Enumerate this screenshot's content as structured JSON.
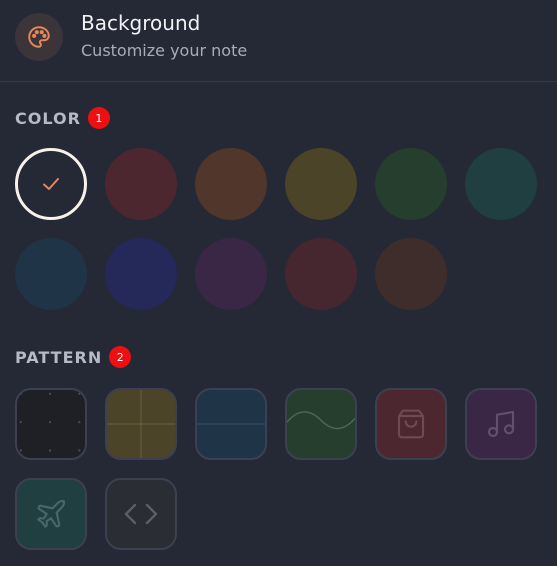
{
  "header": {
    "title": "Background",
    "subtitle": "Customize your note",
    "icon": "palette-icon",
    "icon_color": "#e8865a"
  },
  "color_section": {
    "label": "COLOR",
    "badge": "1",
    "swatches": [
      {
        "name": "default",
        "color": "#252835",
        "selected": true,
        "icon": "check-icon"
      },
      {
        "name": "red",
        "color": "#4c2730",
        "selected": false
      },
      {
        "name": "orange",
        "color": "#51372b",
        "selected": false
      },
      {
        "name": "yellow",
        "color": "#4b4428",
        "selected": false
      },
      {
        "name": "green",
        "color": "#263e2e",
        "selected": false
      },
      {
        "name": "teal",
        "color": "#1f3f40",
        "selected": false
      },
      {
        "name": "blue",
        "color": "#1f3447",
        "selected": false
      },
      {
        "name": "indigo",
        "color": "#24295a",
        "selected": false
      },
      {
        "name": "purple",
        "color": "#3a2645",
        "selected": false
      },
      {
        "name": "crimson",
        "color": "#462730",
        "selected": false
      },
      {
        "name": "brown",
        "color": "#3f2d2c",
        "selected": false
      }
    ],
    "check_color": "#e8865a"
  },
  "pattern_section": {
    "label": "PATTERN",
    "badge": "2",
    "patterns": [
      {
        "name": "dots",
        "bg": "#1f2026",
        "icon": "dot-grid-icon"
      },
      {
        "name": "grid",
        "bg": "#4b4428",
        "icon": "grid-icon"
      },
      {
        "name": "lines",
        "bg": "#1f3447",
        "icon": "lines-icon"
      },
      {
        "name": "wave",
        "bg": "#263e2e",
        "icon": "wave-icon"
      },
      {
        "name": "shopping",
        "bg": "#4c2730",
        "icon": "shopping-bag-icon"
      },
      {
        "name": "music",
        "bg": "#3a2645",
        "icon": "music-note-icon"
      },
      {
        "name": "travel",
        "bg": "#1f3f40",
        "icon": "airplane-icon"
      },
      {
        "name": "code",
        "bg": "#2a2d33",
        "icon": "code-icon"
      }
    ]
  }
}
